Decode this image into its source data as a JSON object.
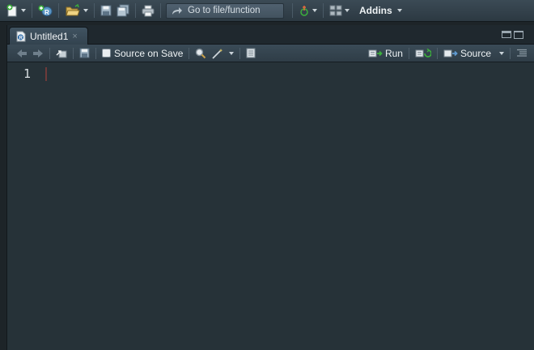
{
  "global_toolbar": {
    "goto_placeholder": "Go to file/function",
    "addins_label": "Addins"
  },
  "editor": {
    "tab_title": "Untitled1",
    "tab_close": "×",
    "source_on_save_label": "Source on Save",
    "source_on_save_checked": false,
    "run_label": "Run",
    "source_label": "Source",
    "line_numbers": [
      "1"
    ],
    "content": ""
  },
  "colors": {
    "editor_background": "#263238",
    "toolbar_background": "#34434e",
    "text": "#eef2f4"
  },
  "icons": {
    "new_file": "new-file-icon",
    "new_project": "new-project-icon",
    "open_file": "open-folder-icon",
    "save": "save-icon",
    "save_all": "save-all-icon",
    "print": "print-icon",
    "goto_arrow": "go-to-arrow-icon",
    "version_control": "git-icon",
    "workspace_panes": "panes-layout-icon",
    "back": "back-arrow-icon",
    "forward": "forward-arrow-icon",
    "show_in_window": "show-in-new-window-icon",
    "find": "magnifier-icon",
    "code_tools": "magic-wand-icon",
    "compile_report": "notebook-icon",
    "run": "run-icon",
    "rerun": "rerun-icon",
    "source": "source-icon",
    "outline": "document-outline-icon"
  }
}
